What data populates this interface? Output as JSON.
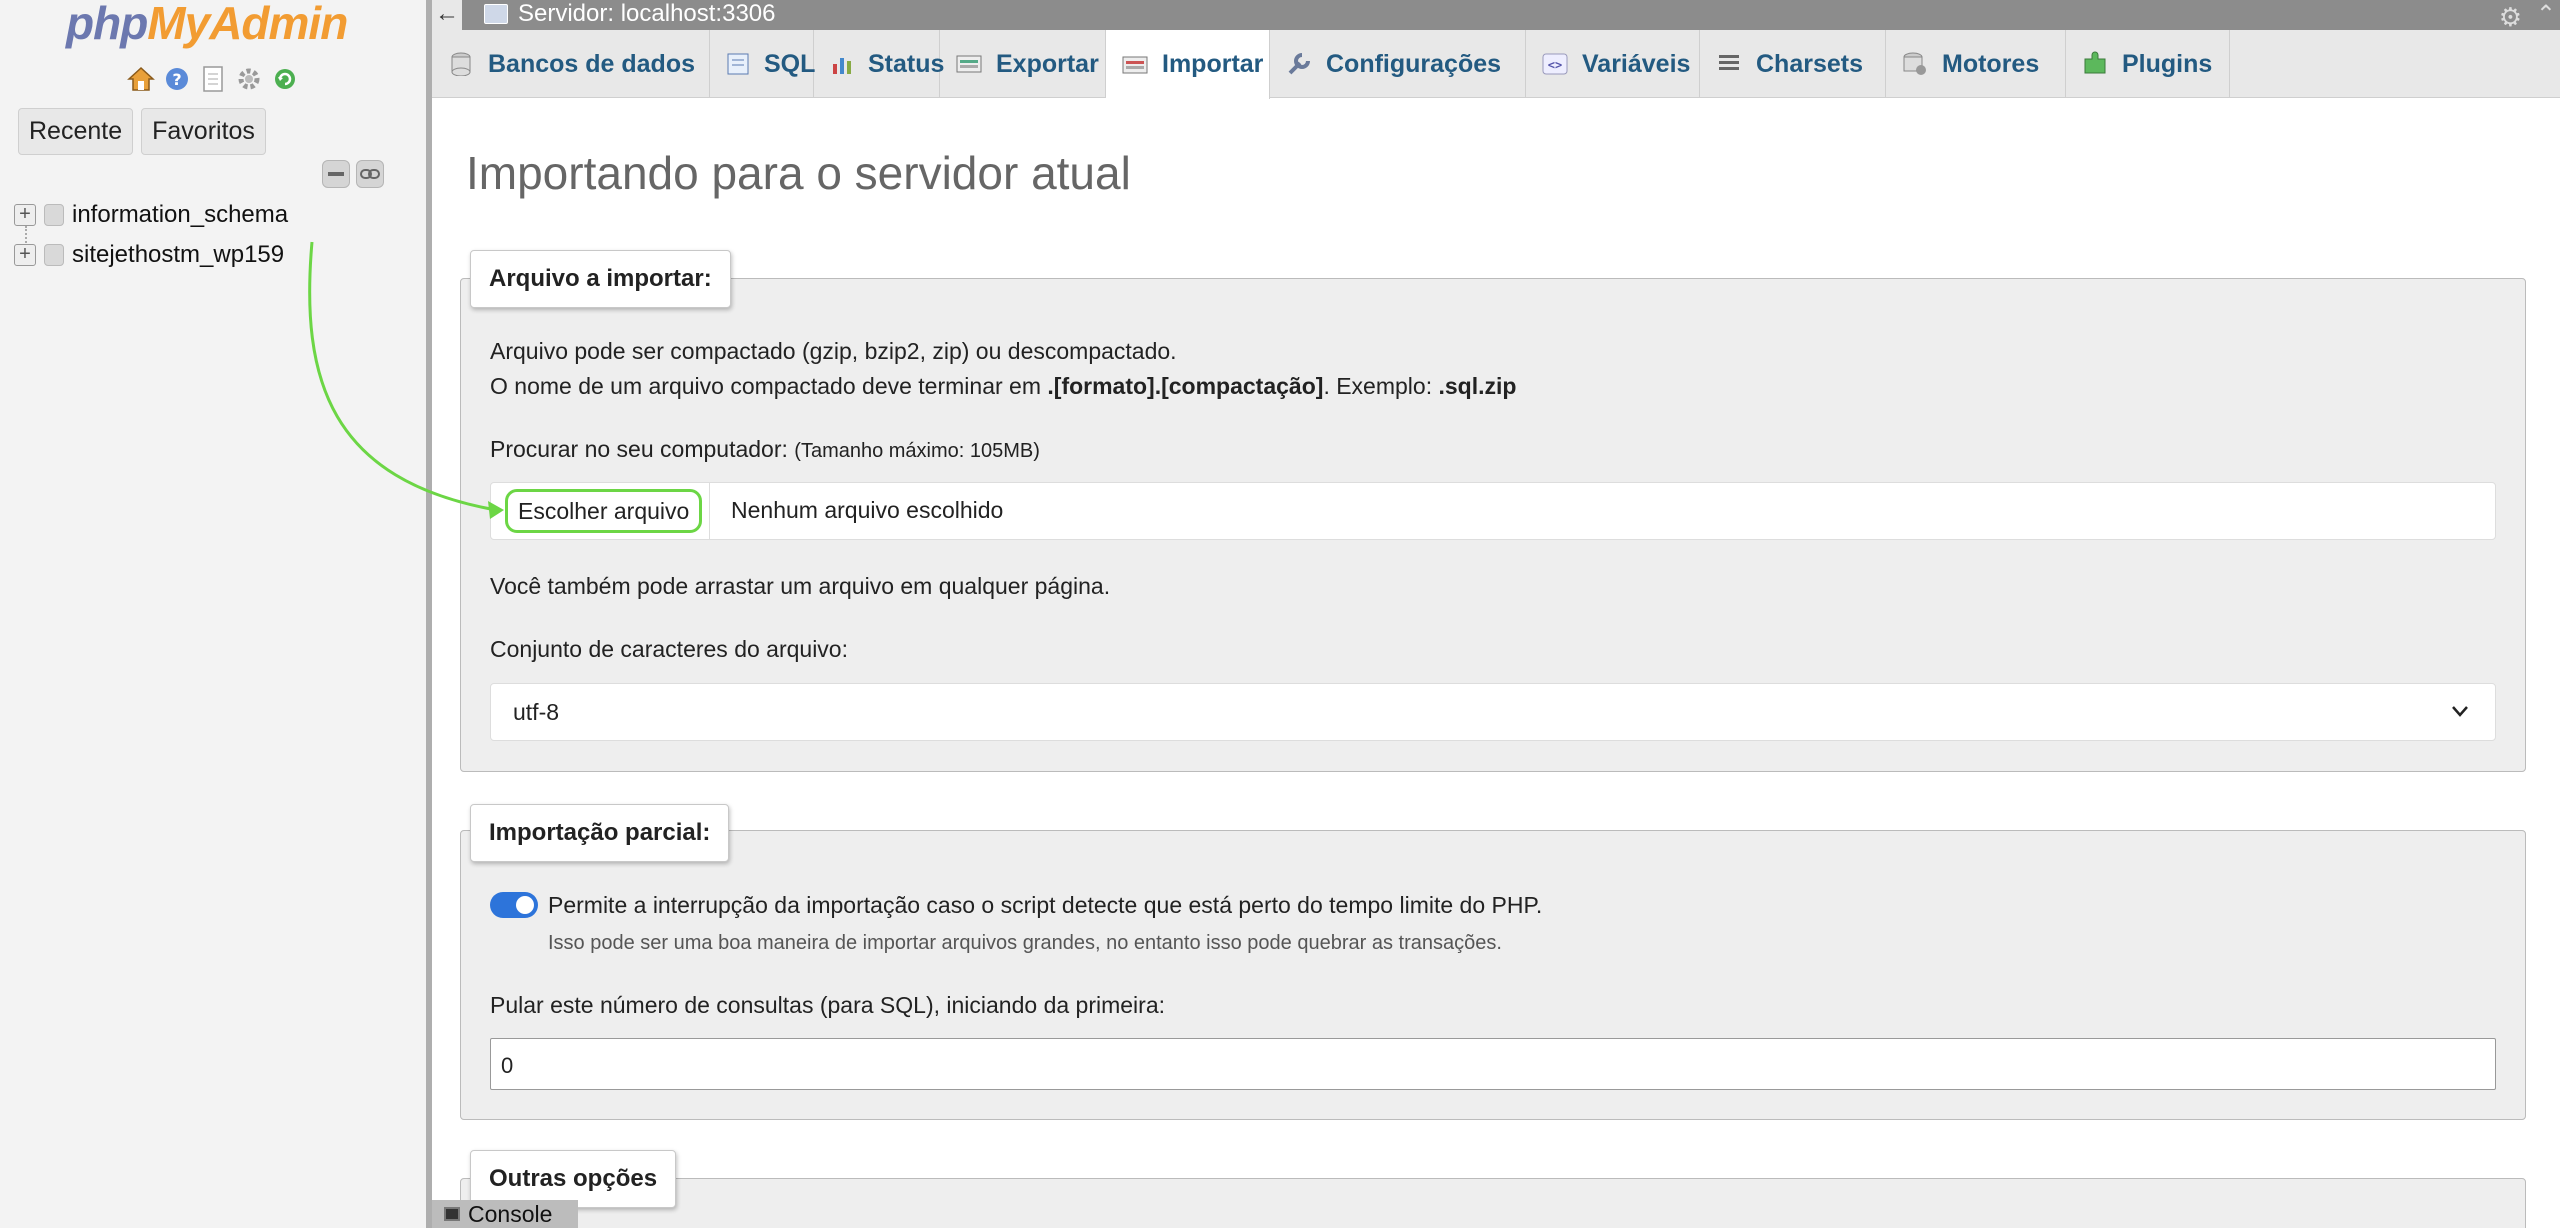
{
  "nav": {
    "logo_php": "php",
    "logo_rest": "MyAdmin",
    "icons": [
      "home-icon",
      "help-icon",
      "docs-icon",
      "settings-icon",
      "reload-icon"
    ],
    "tabs": [
      "Recente",
      "Favoritos"
    ],
    "databases": [
      "information_schema",
      "sitejethostm_wp159"
    ]
  },
  "topbar": {
    "server": "Servidor: localhost:3306",
    "back": "←"
  },
  "tabs": [
    {
      "label": "Bancos de dados",
      "icon": "database-icon"
    },
    {
      "label": "SQL",
      "icon": "sql-icon"
    },
    {
      "label": "Status",
      "icon": "status-icon"
    },
    {
      "label": "Exportar",
      "icon": "export-icon"
    },
    {
      "label": "Importar",
      "icon": "import-icon",
      "active": true
    },
    {
      "label": "Configurações",
      "icon": "wrench-icon"
    },
    {
      "label": "Variáveis",
      "icon": "variables-icon"
    },
    {
      "label": "Charsets",
      "icon": "charsets-icon"
    },
    {
      "label": "Motores",
      "icon": "engines-icon"
    },
    {
      "label": "Plugins",
      "icon": "plugins-icon"
    }
  ],
  "main": {
    "title": "Importando para o servidor atual",
    "file_section": {
      "legend": "Arquivo a importar:",
      "line1": "Arquivo pode ser compactado (gzip, bzip2, zip) ou descompactado.",
      "line2_pre": "O nome de um arquivo compactado deve terminar em ",
      "line2_bold1": ".[formato].[compactação]",
      "line2_mid": ". Exemplo: ",
      "line2_bold2": ".sql.zip",
      "browse_label": "Procurar no seu computador: ",
      "browse_max": "(Tamanho máximo: 105MB)",
      "choose_button": "Escolher arquivo",
      "no_file": "Nenhum arquivo escolhido",
      "drag_hint": "Você também pode arrastar um arquivo em qualquer página.",
      "charset_label": "Conjunto de caracteres do arquivo:",
      "charset_value": "utf-8"
    },
    "partial_section": {
      "legend": "Importação parcial:",
      "interrupt_label": "Permite a interrupção da importação caso o script detecte que está perto do tempo limite do PHP.",
      "interrupt_note": "Isso pode ser uma boa maneira de importar arquivos grandes, no entanto isso pode quebrar as transações.",
      "interrupt_enabled": true,
      "skip_label": "Pular este número de consultas (para SQL), iniciando da primeira:",
      "skip_value": "0"
    },
    "other_section": {
      "legend": "Outras opções"
    }
  },
  "console": {
    "label": "Console"
  },
  "colors": {
    "link": "#235a81",
    "highlight": "#6cd645",
    "toggle": "#2d74da"
  }
}
